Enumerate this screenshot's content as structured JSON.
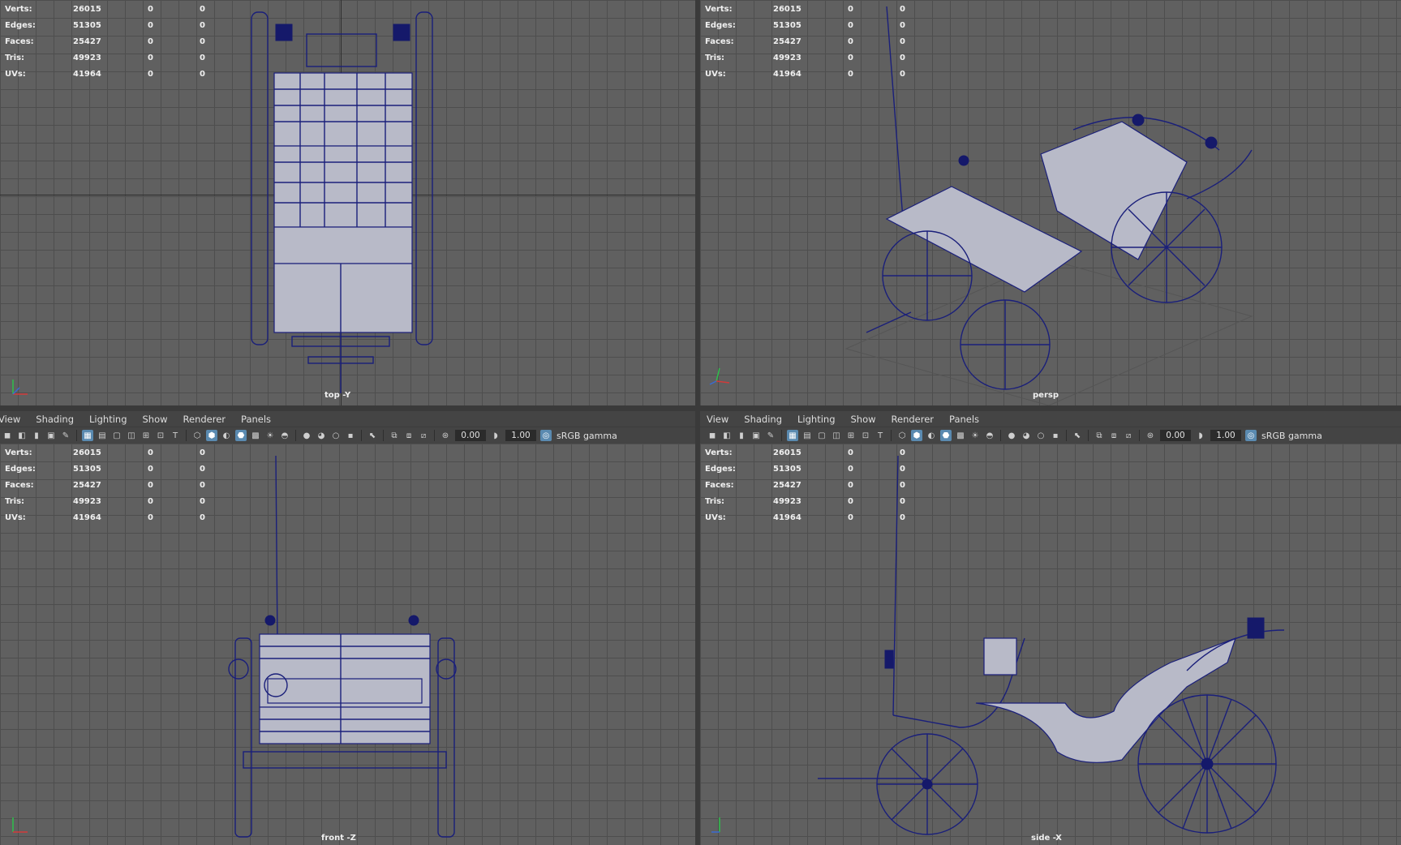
{
  "stats": {
    "labels": [
      "Verts:",
      "Edges:",
      "Faces:",
      "Tris:",
      "UVs:"
    ],
    "values": [
      "26015",
      "51305",
      "25427",
      "49923",
      "41964"
    ],
    "zeros": "0"
  },
  "viewports": {
    "top": {
      "camera": "top -Y"
    },
    "persp": {
      "camera": "persp"
    },
    "front": {
      "camera": "front -Z"
    },
    "side": {
      "camera": "side -X"
    }
  },
  "menu": {
    "view": "View",
    "shading": "Shading",
    "lighting": "Lighting",
    "show": "Show",
    "renderer": "Renderer",
    "panels": "Panels"
  },
  "toolbar": {
    "exposure": "0.00",
    "gamma": "1.00",
    "colorspace": "sRGB gamma"
  },
  "colors": {
    "wireframe": "#1a1f7a",
    "viewport_bg": "#606060",
    "grid": "#4e4e4e",
    "toolbar_bg": "#444444",
    "active_icon": "#5a8ab0"
  },
  "icons": [
    "camera-icon",
    "bookmark-icon",
    "grid-icon",
    "film-gate-icon",
    "wireframe-shading-icon",
    "smooth-shading-icon",
    "texture-icon",
    "light-icon",
    "shadow-icon",
    "xray-icon",
    "isolate-icon",
    "exposure-icon",
    "gamma-icon",
    "color-management-icon"
  ]
}
